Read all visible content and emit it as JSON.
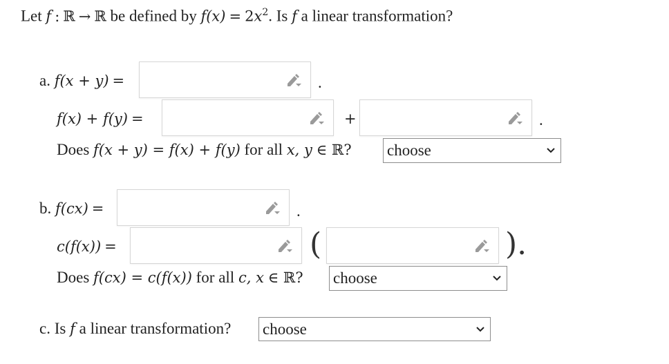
{
  "question": {
    "prefix": "Let",
    "f": "f",
    "colon": ":",
    "domain": "ℝ",
    "arrow": "→",
    "codomain": "ℝ",
    "be_defined_by": "be defined by",
    "def_lhs": "f(x)",
    "eq": "=",
    "def_rhs_coef": "2",
    "def_rhs_var": "x",
    "def_rhs_exp": "2",
    "is": ". Is",
    "suffix": "a linear transformation?"
  },
  "part_a": {
    "label": "a.",
    "expr1": "f(x + y)",
    "eq": "=",
    "dot1": ".",
    "expr2": "f(x) + f(y)",
    "plus": "+",
    "dot2": ".",
    "does_prefix": "Does",
    "does_expr": "f(x + y) = f(x) + f(y)",
    "does_for": "for all",
    "does_vars": "x, y",
    "does_in": "∈ ℝ?",
    "select_value": "choose",
    "input1_value": "",
    "input2_value": "",
    "input3_value": ""
  },
  "part_b": {
    "label": "b.",
    "expr1": "f(cx)",
    "eq": "=",
    "dot1": ".",
    "expr2": "c(f(x))",
    "open_paren": "(",
    "close_paren": ").",
    "does_prefix": "Does",
    "does_expr": "f(cx) = c(f(x))",
    "does_for": "for all",
    "does_vars": "c, x",
    "does_in": "∈ ℝ?",
    "select_value": "choose",
    "input1_value": "",
    "input2_value": "",
    "input3_value": ""
  },
  "part_c": {
    "label": "c. Is",
    "f": "f",
    "suffix": "a linear transformation?",
    "select_value": "choose"
  },
  "icons": {
    "pencil": "pencil-dropdown-icon",
    "chevron": "chevron-down-icon"
  },
  "colors": {
    "input_border": "#d6d6d6",
    "select_border": "#8c8c8c",
    "icon": "#9a9a9a",
    "text": "#222222"
  }
}
